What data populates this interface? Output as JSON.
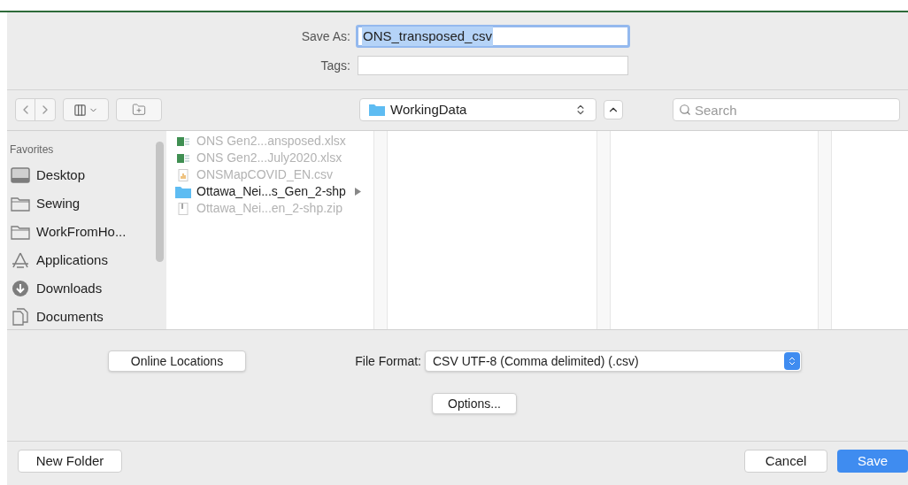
{
  "save_as": {
    "label": "Save As:",
    "value": "ONS_transposed_csv"
  },
  "tags": {
    "label": "Tags:"
  },
  "location": {
    "folder": "WorkingData"
  },
  "search": {
    "placeholder": "Search"
  },
  "sidebar": {
    "heading": "Favorites",
    "items": [
      {
        "label": "Desktop",
        "kind": "desktop"
      },
      {
        "label": "Sewing",
        "kind": "folder"
      },
      {
        "label": "WorkFromHo...",
        "kind": "folder"
      },
      {
        "label": "Applications",
        "kind": "apps"
      },
      {
        "label": "Downloads",
        "kind": "downloads"
      },
      {
        "label": "Documents",
        "kind": "documents"
      }
    ]
  },
  "files": [
    {
      "name": "ONS Gen2...ansposed.xlsx",
      "kind": "xlsx",
      "disabled": true
    },
    {
      "name": "ONS Gen2...July2020.xlsx",
      "kind": "xlsx",
      "disabled": true
    },
    {
      "name": "ONSMapCOVID_EN.csv",
      "kind": "csv",
      "disabled": true
    },
    {
      "name": "Ottawa_Nei...s_Gen_2-shp",
      "kind": "folder",
      "disabled": false
    },
    {
      "name": "Ottawa_Nei...en_2-shp.zip",
      "kind": "zip",
      "disabled": true
    }
  ],
  "online_locations": "Online Locations",
  "file_format": {
    "label": "File Format:",
    "value": "CSV UTF-8 (Comma delimited) (.csv)"
  },
  "options": "Options...",
  "new_folder": "New Folder",
  "cancel": "Cancel",
  "save": "Save"
}
